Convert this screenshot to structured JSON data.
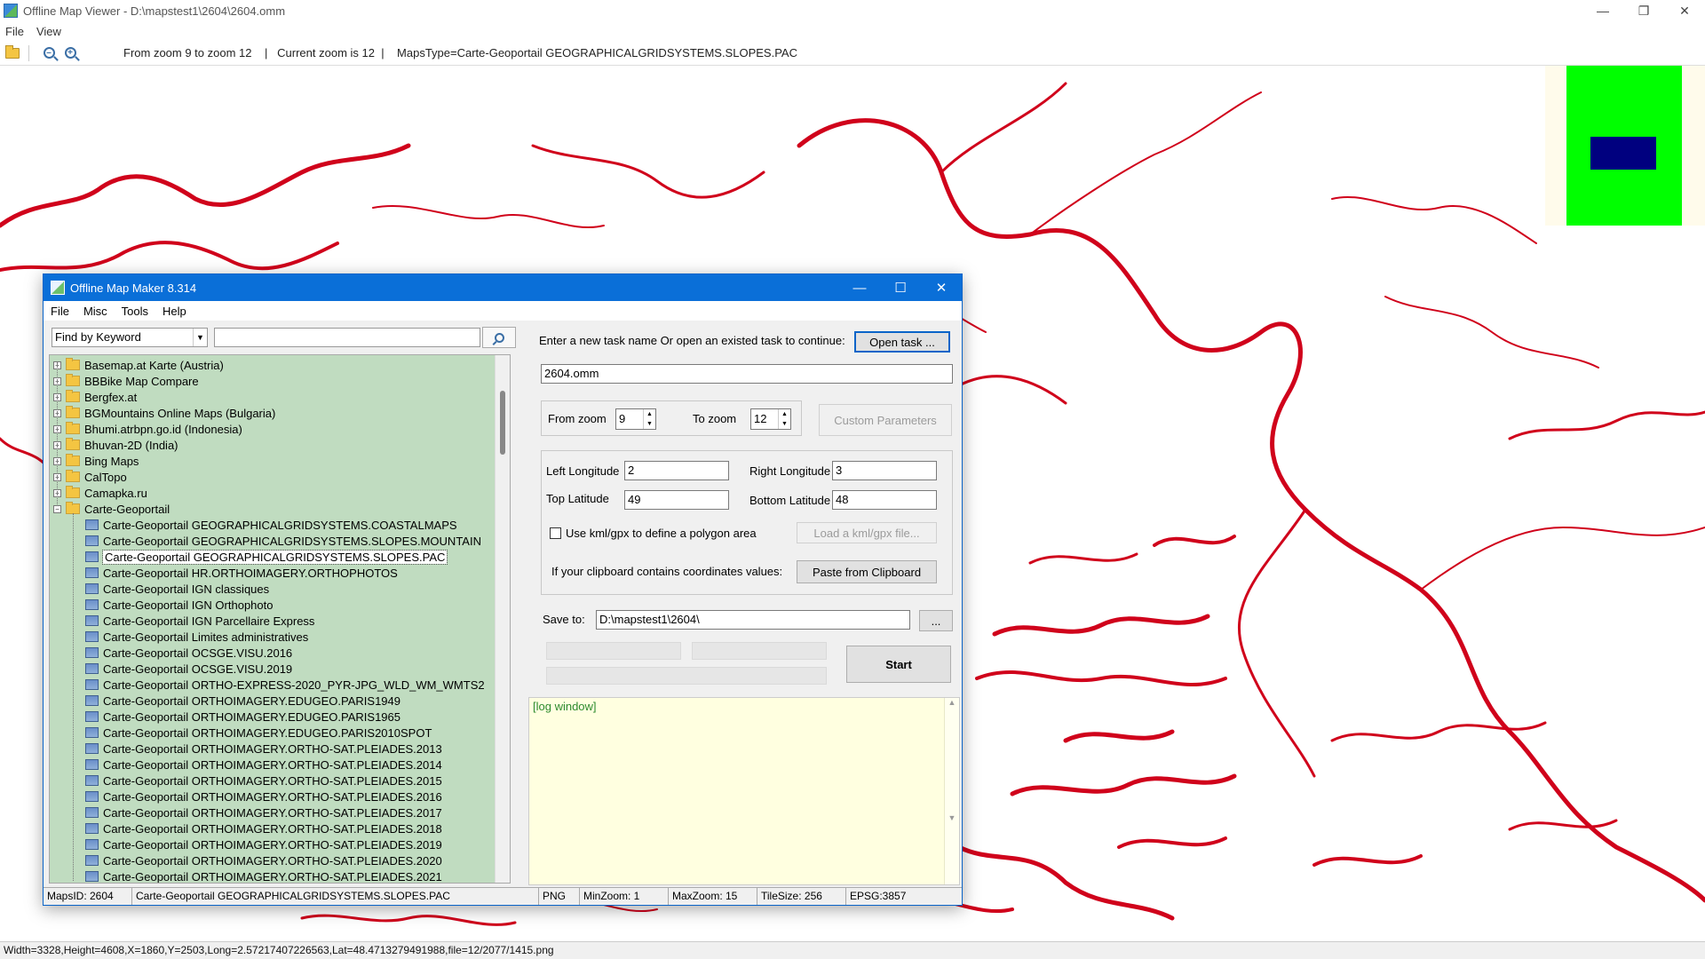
{
  "viewer": {
    "title": "Offline Map Viewer - D:\\mapstest1\\2604\\2604.omm",
    "menu": [
      "File",
      "View"
    ],
    "toolbar_text": "From zoom 9 to zoom 12    |   Current zoom is 12  |    MapsType=Carte-Geoportail GEOGRAPHICALGRIDSYSTEMS.SLOPES.PAC",
    "status": "Width=3328,Height=4608,X=1860,Y=2503,Long=2.57217407226563,Lat=48.4713279491988,file=12/2077/1415.png",
    "colors": {
      "map_lines": "#d0021b",
      "overview_bg": "#00ff00",
      "overview_view": "#00007f"
    }
  },
  "dialog": {
    "title": "Offline Map Maker 8.314",
    "menu": [
      "File",
      "Misc",
      "Tools",
      "Help"
    ],
    "find_mode": "Find by Keyword",
    "find_value": "",
    "tree": {
      "folders": [
        "Basemap.at Karte (Austria)",
        "BBBike Map Compare",
        "Bergfex.at",
        "BGMountains Online Maps (Bulgaria)",
        "Bhumi.atrbpn.go.id (Indonesia)",
        "Bhuvan-2D (India)",
        "Bing Maps",
        "CalTopo",
        "Camapka.ru",
        "Carte-Geoportail"
      ],
      "children": [
        "Carte-Geoportail GEOGRAPHICALGRIDSYSTEMS.COASTALMAPS",
        "Carte-Geoportail GEOGRAPHICALGRIDSYSTEMS.SLOPES.MOUNTAIN",
        "Carte-Geoportail GEOGRAPHICALGRIDSYSTEMS.SLOPES.PAC",
        "Carte-Geoportail HR.ORTHOIMAGERY.ORTHOPHOTOS",
        "Carte-Geoportail IGN classiques",
        "Carte-Geoportail IGN Orthophoto",
        "Carte-Geoportail IGN Parcellaire Express",
        "Carte-Geoportail Limites administratives",
        "Carte-Geoportail OCSGE.VISU.2016",
        "Carte-Geoportail OCSGE.VISU.2019",
        "Carte-Geoportail ORTHO-EXPRESS-2020_PYR-JPG_WLD_WM_WMTS2",
        "Carte-Geoportail ORTHOIMAGERY.EDUGEO.PARIS1949",
        "Carte-Geoportail ORTHOIMAGERY.EDUGEO.PARIS1965",
        "Carte-Geoportail ORTHOIMAGERY.EDUGEO.PARIS2010SPOT",
        "Carte-Geoportail ORTHOIMAGERY.ORTHO-SAT.PLEIADES.2013",
        "Carte-Geoportail ORTHOIMAGERY.ORTHO-SAT.PLEIADES.2014",
        "Carte-Geoportail ORTHOIMAGERY.ORTHO-SAT.PLEIADES.2015",
        "Carte-Geoportail ORTHOIMAGERY.ORTHO-SAT.PLEIADES.2016",
        "Carte-Geoportail ORTHOIMAGERY.ORTHO-SAT.PLEIADES.2017",
        "Carte-Geoportail ORTHOIMAGERY.ORTHO-SAT.PLEIADES.2018",
        "Carte-Geoportail ORTHOIMAGERY.ORTHO-SAT.PLEIADES.2019",
        "Carte-Geoportail ORTHOIMAGERY.ORTHO-SAT.PLEIADES.2020",
        "Carte-Geoportail ORTHOIMAGERY.ORTHO-SAT.PLEIADES.2021"
      ],
      "selected_child": 2
    },
    "task_prompt": "Enter a new task name Or open an existed task to continue:",
    "open_task": "Open task ...",
    "task_name": "2604.omm",
    "from_zoom_label": "From zoom",
    "from_zoom": "9",
    "to_zoom_label": "To zoom",
    "to_zoom": "12",
    "custom_params": "Custom Parameters",
    "left_lon_label": "Left Longitude",
    "left_lon": "2",
    "right_lon_label": "Right Longitude",
    "right_lon": "3",
    "top_lat_label": "Top Latitude",
    "top_lat": "49",
    "bottom_lat_label": "Bottom Latitude",
    "bottom_lat": "48",
    "kml_label": "Use kml/gpx to define a polygon area",
    "load_kml": "Load a kml/gpx file...",
    "clipboard_label": "If your clipboard contains coordinates values:",
    "paste_clipboard": "Paste from Clipboard",
    "save_label": "Save to:",
    "save_path": "D:\\mapstest1\\2604\\",
    "browse": "...",
    "start": "Start",
    "log": "[log window]",
    "status": {
      "maps_id": "MapsID: 2604",
      "maps_name": "Carte-Geoportail GEOGRAPHICALGRIDSYSTEMS.SLOPES.PAC",
      "format": "PNG",
      "min_zoom": "MinZoom: 1",
      "max_zoom": "MaxZoom: 15",
      "tile_size": "TileSize: 256",
      "epsg": "EPSG:3857"
    }
  }
}
